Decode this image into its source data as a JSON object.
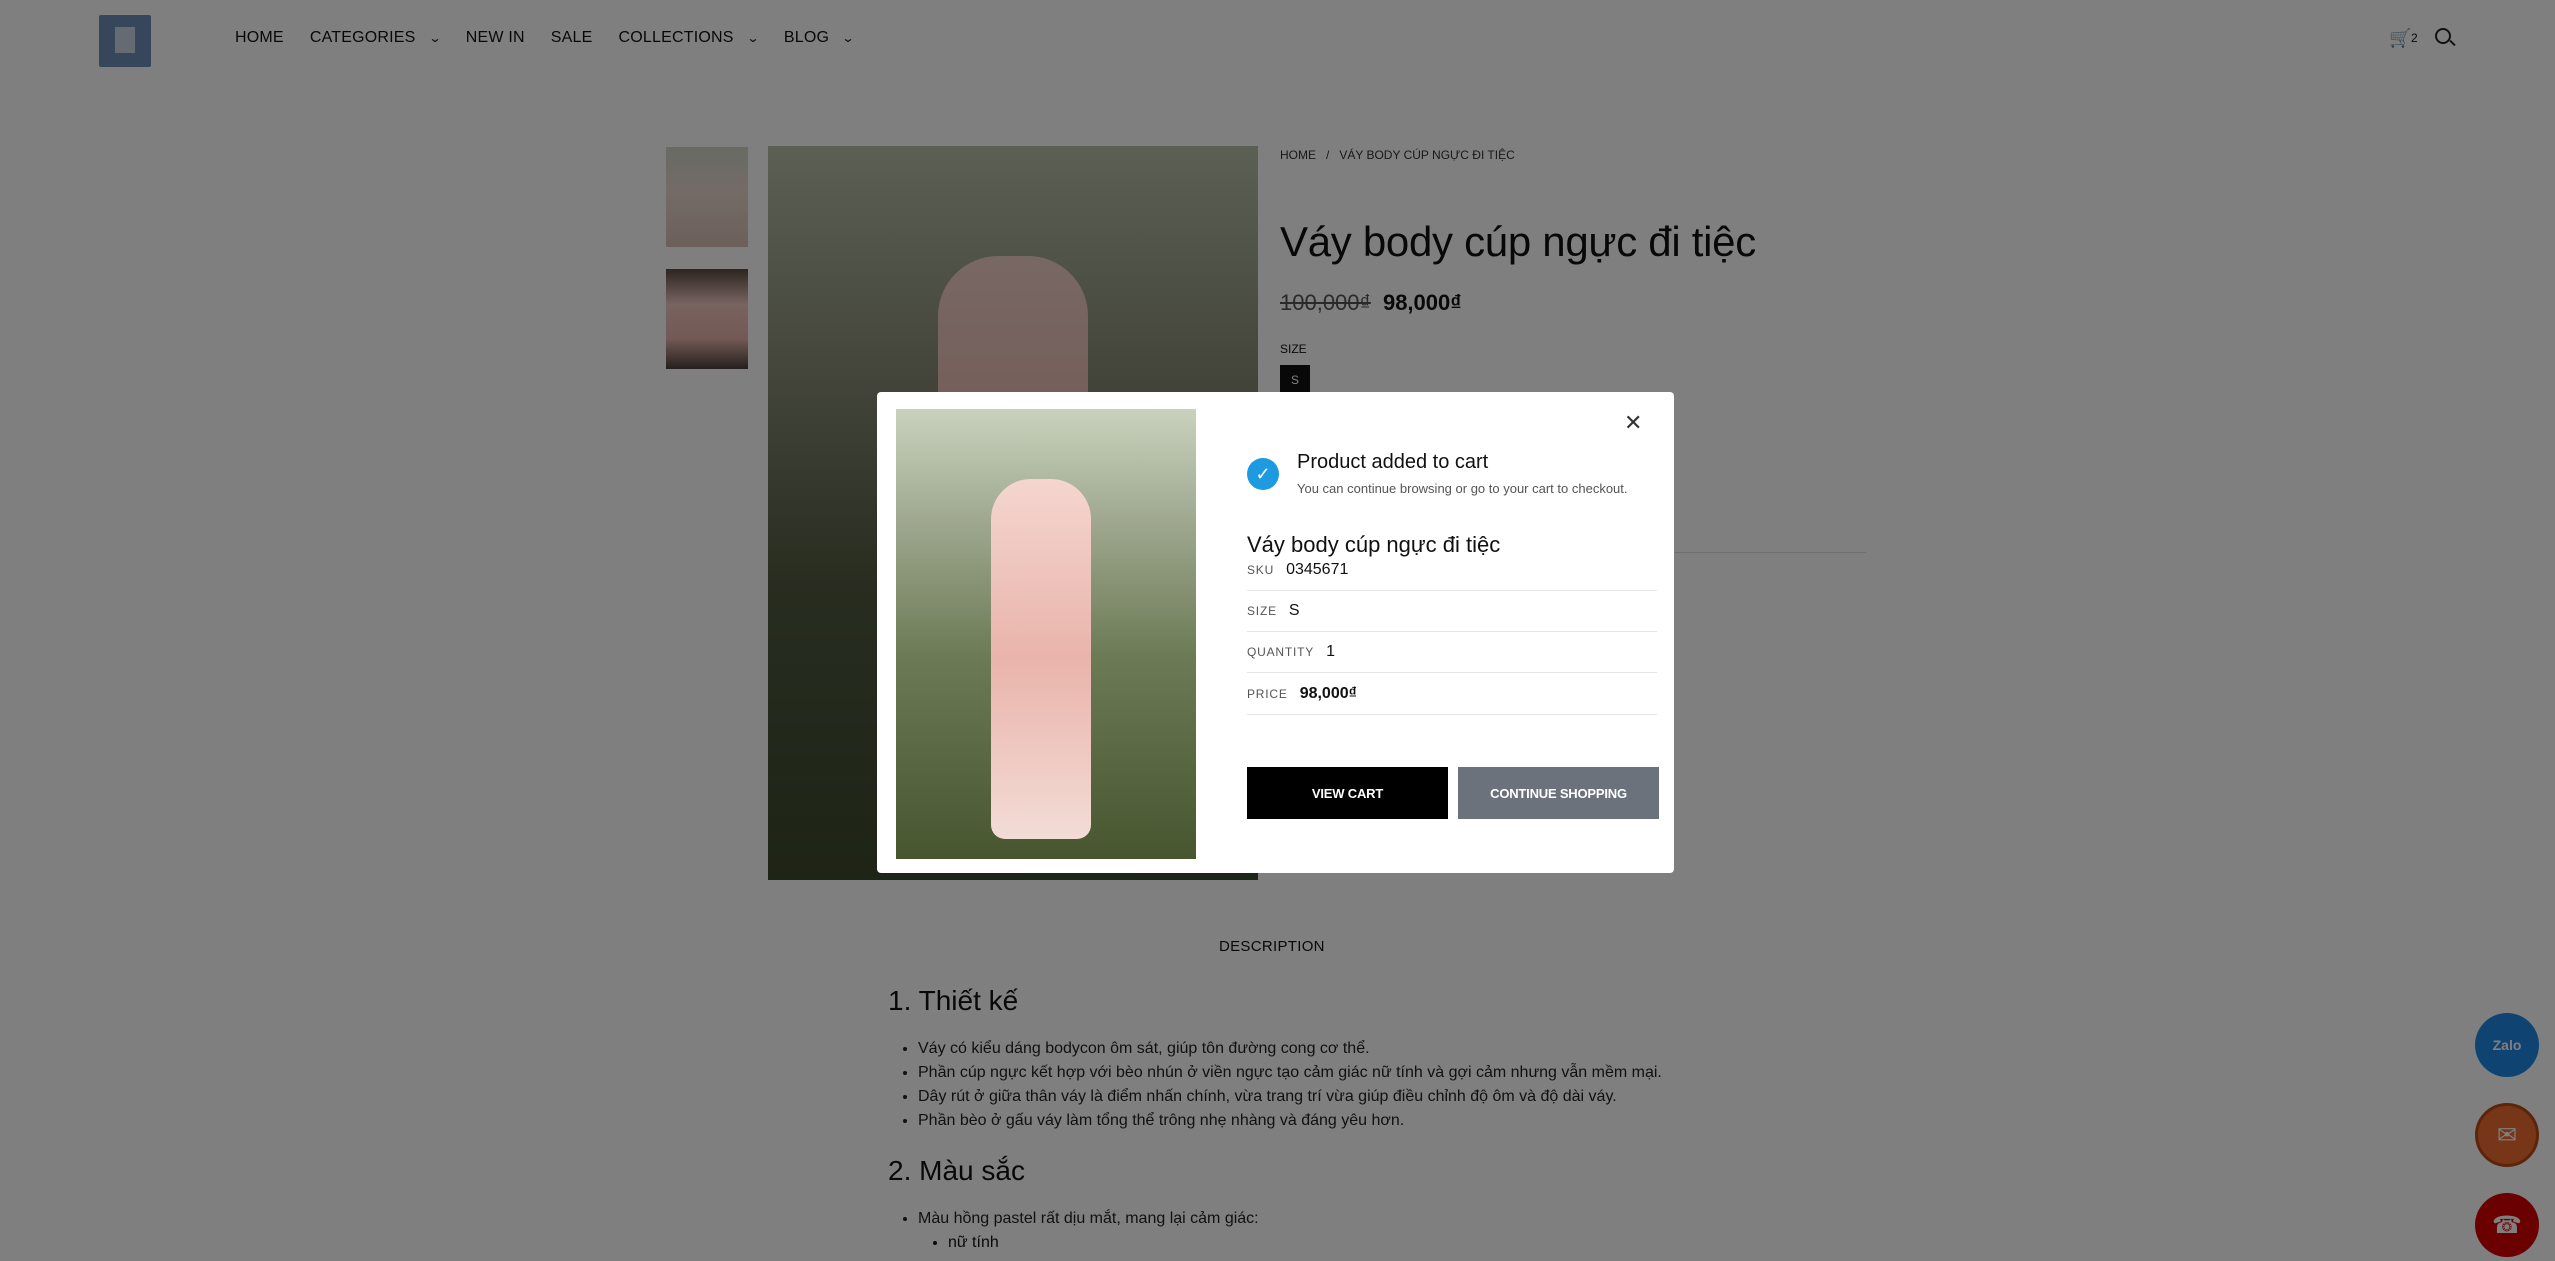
{
  "header": {
    "nav": [
      {
        "label": "HOME",
        "has_dropdown": false
      },
      {
        "label": "CATEGORIES",
        "has_dropdown": true
      },
      {
        "label": "NEW IN",
        "has_dropdown": false
      },
      {
        "label": "SALE",
        "has_dropdown": false
      },
      {
        "label": "COLLECTIONS",
        "has_dropdown": true
      },
      {
        "label": "BLOG",
        "has_dropdown": true
      }
    ],
    "cart_count": "2"
  },
  "breadcrumb": {
    "home": "HOME",
    "sep": "/",
    "current": "VÁY BODY CÚP NGỰC ĐI TIỆC"
  },
  "product": {
    "title": "Váy body cúp ngực đi tiệc",
    "old_price": "100,000₫",
    "price": "98,000₫",
    "size_label": "SIZE",
    "size_value": "S"
  },
  "description": {
    "tab": "DESCRIPTION",
    "section1_title": "1. Thiết kế",
    "section1_items": [
      "Váy có kiểu dáng bodycon ôm sát, giúp tôn đường cong cơ thể.",
      "Phần cúp ngực kết hợp với bèo nhún ở viền ngực tạo cảm giác nữ tính và gợi cảm nhưng vẫn mềm mại.",
      "Dây rút ở giữa thân váy là điểm nhấn chính, vừa trang trí vừa giúp điều chỉnh độ ôm và độ dài váy.",
      "Phần bèo ở gấu váy làm tổng thể trông nhẹ nhàng và đáng yêu hơn."
    ],
    "section2_title": "2. Màu sắc",
    "section2_items": [
      "Màu hồng pastel rất dịu mắt, mang lại cảm giác:"
    ],
    "section2_sub": [
      "nữ tính"
    ]
  },
  "modal": {
    "heading": "Product added to cart",
    "subheading": "You can continue browsing or go to your cart to checkout.",
    "product_title": "Váy body cúp ngực đi tiệc",
    "rows": {
      "sku_label": "SKU",
      "sku": "0345671",
      "size_label": "SIZE",
      "size": "S",
      "qty_label": "QUANTITY",
      "qty": "1",
      "price_label": "PRICE",
      "price": "98,000₫"
    },
    "view_cart": "VIEW CART",
    "continue": "CONTINUE SHOPPING"
  },
  "icons": {
    "cart": "cart-icon",
    "search": "search-icon",
    "close": "close-icon",
    "check": "check-circle-icon",
    "zalo": "zalo-icon",
    "messenger": "messenger-icon",
    "phone": "phone-icon"
  },
  "floating": {
    "zalo_label": "Zalo"
  },
  "colors": {
    "accent": "#1e9be0",
    "view_cart_bg": "#000000",
    "continue_bg": "#6b727c",
    "zalo": "#1e88e5",
    "messenger": "#ef6c2e",
    "phone": "#d50000"
  }
}
